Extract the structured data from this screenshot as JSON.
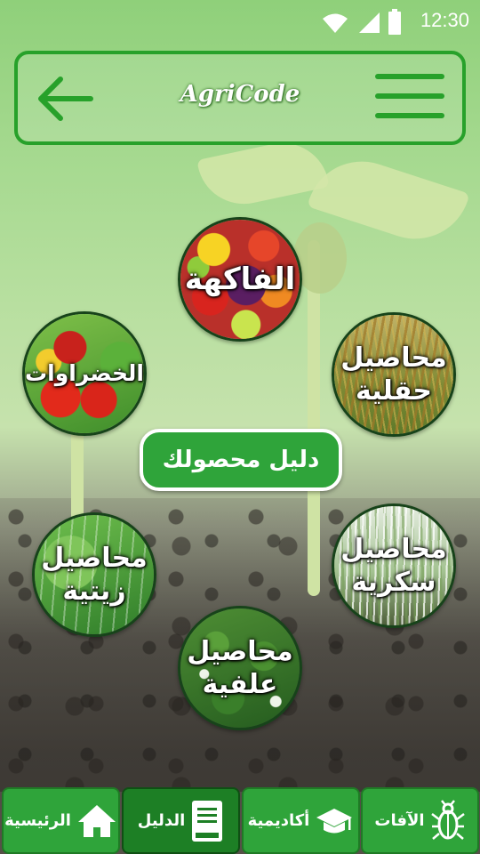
{
  "status_bar": {
    "time": "12:30",
    "icons": [
      "wifi-icon",
      "signal-icon",
      "battery-icon"
    ]
  },
  "header": {
    "title": "AgriCode",
    "back_icon": "arrow-left-icon",
    "menu_icon": "hamburger-menu-icon"
  },
  "categories": [
    {
      "id": "fruits",
      "label": "الفاكهة"
    },
    {
      "id": "vegetables",
      "label": "الخضراوات"
    },
    {
      "id": "field",
      "label": "محاصيل حقلية"
    },
    {
      "id": "oil",
      "label": "محاصيل زيتية"
    },
    {
      "id": "sugar",
      "label": "محاصيل سكرية"
    },
    {
      "id": "forage",
      "label": "محاصيل علفية"
    }
  ],
  "center_label": "دليل محصولك",
  "bottom_nav": [
    {
      "label": "الرئيسية",
      "icon": "home-icon",
      "active": false
    },
    {
      "label": "الدليل",
      "icon": "book-icon",
      "active": true
    },
    {
      "label": "أكاديمية",
      "icon": "graduation-cap-icon",
      "active": false
    },
    {
      "label": "الآفات",
      "icon": "bug-icon",
      "active": false
    }
  ],
  "colors": {
    "primary": "#2fa43a",
    "primary_dark": "#1d7f25",
    "header_border": "#27a12a"
  }
}
